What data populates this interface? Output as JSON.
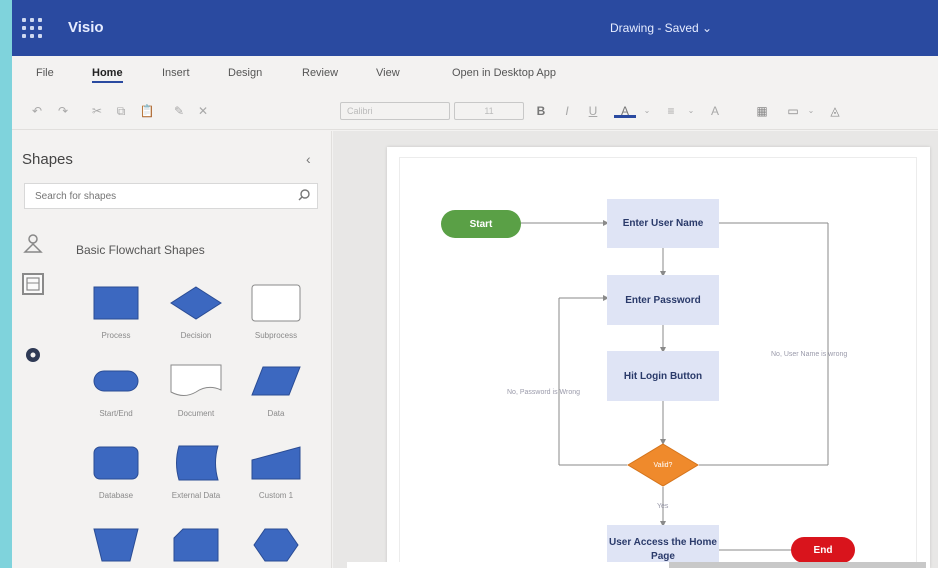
{
  "app": {
    "name": "Visio",
    "doc_title": "Drawing - Saved ⌄"
  },
  "menu": {
    "items": [
      {
        "label": "File"
      },
      {
        "label": "Home"
      },
      {
        "label": "Insert"
      },
      {
        "label": "Design"
      },
      {
        "label": "Review"
      },
      {
        "label": "View"
      },
      {
        "label": "Open in Desktop App"
      }
    ],
    "active": "Home"
  },
  "toolbar": {
    "font_placeholder": "Calibri",
    "font_size": "11"
  },
  "shapes_panel": {
    "title": "Shapes",
    "collapse_glyph": "‹",
    "search_placeholder": "Search for shapes",
    "stencil_title": "Basic Flowchart Shapes",
    "shapes": [
      {
        "label": "Process",
        "icon": "process-shape-icon"
      },
      {
        "label": "Decision",
        "icon": "decision-shape-icon"
      },
      {
        "label": "Subprocess",
        "icon": "subprocess-shape-icon"
      },
      {
        "label": "Start/End",
        "icon": "start-end-shape-icon"
      },
      {
        "label": "Document",
        "icon": "document-shape-icon"
      },
      {
        "label": "Data",
        "icon": "data-shape-icon"
      },
      {
        "label": "Database",
        "icon": "database-shape-icon"
      },
      {
        "label": "External Data",
        "icon": "external-data-shape-icon"
      },
      {
        "label": "Custom 1",
        "icon": "custom-1-shape-icon"
      },
      {
        "label": "",
        "icon": "trapezoid-shape-icon"
      },
      {
        "label": "",
        "icon": "stored-data-shape-icon"
      },
      {
        "label": "",
        "icon": "hexagon-shape-icon"
      }
    ]
  },
  "diagram": {
    "start": "Start",
    "enter_user_name": "Enter User Name",
    "enter_password": "Enter Password",
    "hit_login": "Hit Login Button",
    "decision": "Valid?",
    "user_access": "User Access the Home Page",
    "end": "End",
    "label_no_user": "No, User Name is wrong",
    "label_no_password": "No, Password is Wrong",
    "label_yes": "Yes"
  },
  "colors": {
    "titlebar": "#2a4aa0",
    "start_node": "#5aa046",
    "end_node": "#d9141c",
    "decision_node": "#ef8a2c",
    "process_fill": "#dfe4f5",
    "stencil_shape": "#3c68c0"
  }
}
